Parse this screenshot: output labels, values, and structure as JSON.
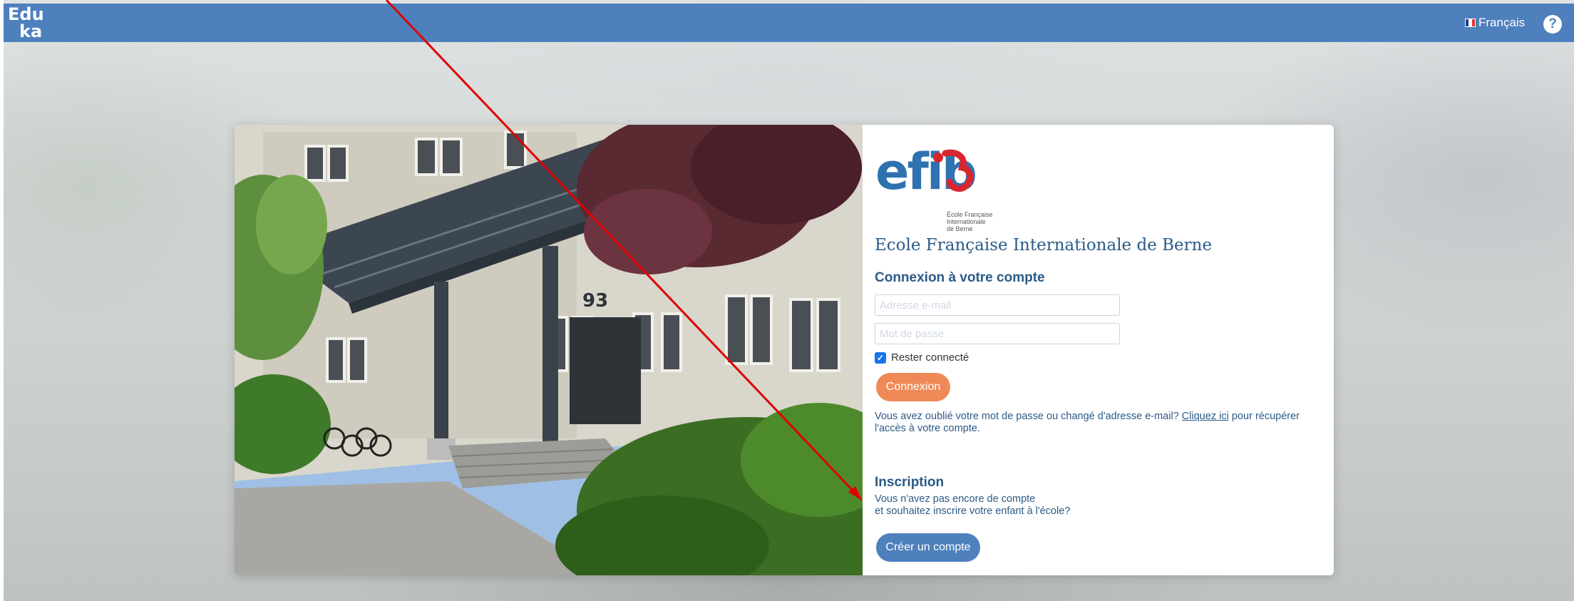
{
  "topbar": {
    "brand_line1": "Edu",
    "brand_line2": "ka",
    "language": "Français",
    "help_symbol": "?"
  },
  "logo": {
    "text": "efib",
    "subtitle": "École Française\nInternationale\nde Berne"
  },
  "login": {
    "school_name": "Ecole Française Internationale de Berne",
    "title": "Connexion à votre compte",
    "email_placeholder": "Adresse e-mail",
    "password_placeholder": "Mot de passe",
    "remember_label": "Rester connecté",
    "remember_checked": true,
    "submit_label": "Connexion",
    "forgot_before": "Vous avez oublié votre mot de passe ou changé d'adresse e-mail? ",
    "forgot_link": "Cliquez ici",
    "forgot_after": " pour récupérer l'accès à votre compte."
  },
  "registration": {
    "title": "Inscription",
    "text_line1": "Vous n'avez pas encore de compte",
    "text_line2": "et souhaitez inscrire votre enfant à l'école?",
    "button_label": "Créer un compte"
  },
  "photo": {
    "house_number": "93"
  },
  "colors": {
    "topbar": "#4e80bd",
    "accent_orange": "#ef8a58",
    "title_blue": "#2b5a86",
    "logo_blue": "#2f72b0",
    "logo_red": "#d9262e",
    "annotation_arrow": "#e00000"
  }
}
